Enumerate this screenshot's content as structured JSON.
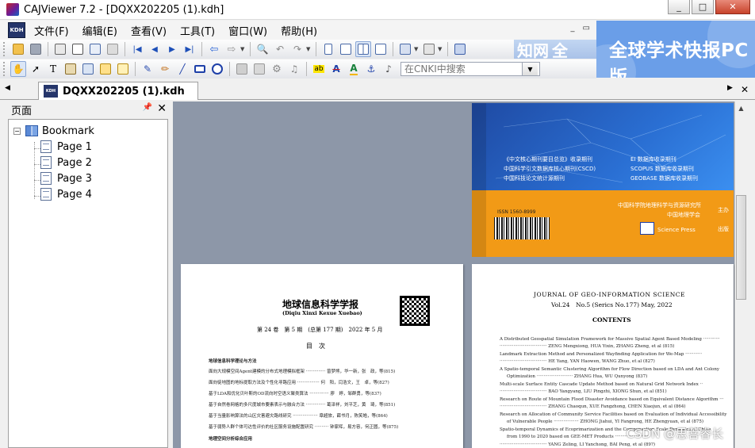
{
  "window": {
    "title": "CAJViewer 7.2 - [DQXX202205 (1).kdh]",
    "buttons": [
      "_",
      "□",
      "✕"
    ]
  },
  "menu": {
    "items": [
      "文件(F)",
      "编辑(E)",
      "查看(V)",
      "工具(T)",
      "窗口(W)",
      "帮助(H)"
    ],
    "mdi_buttons": [
      "_",
      "▭"
    ]
  },
  "toolbar": {
    "search_placeholder": "在CNKI中搜索"
  },
  "banner": {
    "text": "全球学术快报PC版",
    "overlay_fragments": [
      "知网",
      "全"
    ]
  },
  "document_tab": {
    "label": "DQXX202205 (1).kdh"
  },
  "left_panel": {
    "title": "页面",
    "pin_icon": "pin-icon",
    "tree": {
      "root": "Bookmark",
      "children": [
        "Page 1",
        "Page 2",
        "Page 3",
        "Page 4"
      ]
    }
  },
  "cover": {
    "left_lines": [
      "《中文核心期刊要目总览》收录期刊",
      "中国科学引文数据库核心期刊(CSCD)",
      "中国科技论文统计源期刊"
    ],
    "right_lines": [
      "EI 数据库收录期刊",
      "SCOPUS 数据库收录期刊",
      "GEOBASE 数据库收录期刊"
    ],
    "sponsor_lines": [
      "中国科学院地理科学与资源研究所",
      "中国地理学会"
    ],
    "sponsor_suffix": "主办",
    "issn": "ISSN 1560-8999",
    "publisher": "Science Press",
    "publisher_suffix": "出版"
  },
  "page_left": {
    "title": "地球信息科学学报",
    "subtitle": "(Diqiu Xinxi Kexue Xuebao)",
    "issue": "第 24 卷　第 5 期　(总第 177 期)　2022 年 5 月",
    "contents_label": "目　次",
    "section1": "地球信息科学理论与方法",
    "toc": [
      "面向大规模空间Agent建模的分布式地理模拟框架 ·············· 曾梦熊，华一新，张　政，等(815)",
      "面向徒地图的地标提取方法及个性化寻路应用 ················ 何　阳，闫浩文，王　卓，等(827)",
      "基于LDA和优化贝叶斯的OD流向时空语义聚类算法 ·············· 廖　婷，邹群勇，等(837)",
      "基于自然卷网格的多尺度城市要素表示与融合方法 ·············· 葛泽祥，刘平芝，黄　琦，等(851)",
      "基于当量影响算法的山区灾害避灾路线研究 ·················· 章超旅，薛书月，陈笑皓，等(864)",
      "基于弱势人群个体可达性评价的社区服务设施配置研究 ·········· 钟家晖，易方容，何正圆，等(875)"
    ],
    "section2": "地理空间分析综合应用"
  },
  "page_right": {
    "journal": "JOURNAL OF GEO-INFORMATION SCIENCE",
    "volume": "Vol.24　No.5 (Serics No.177) May, 2022",
    "contents_label": "CONTENTS",
    "toc": [
      "A Distributed Geospatial Simulation Framework for Massive Spatial Agent Based Modeling ············",
      "·································· ZENG Mengxiong, HUA Yixin, ZHANG Zheng, et al (815)",
      "Landmark Extraction Method and Personalized Wayfinding Application for We-Map ············",
      "·································· HE Yang, YAN Haowen, WANG Zhuo, et al (827)",
      "A Spatio-temporal Semantic Clustering Algorithm for Flow Direction based on LDA and Ant Colony",
      "Optimization ·························· ZHANG Hua, WU Qunyong (837)",
      "Multi-scale Surface Entity Cascade Update Method based on Natural Grid Network Index ··",
      "·································· BAO Yangyang, LIU Pingzhi, XIONG Shun, et al (851)",
      "Research on Route of Mountain Flood Disaster Avoidance based on Equivalent Distance Algorithm ···",
      "·································· ZHANG Chaoqun, XUE Fangzhong, CHEN Xiaojun, et al (864)",
      "Research on Allocation of Community Service Facilities based on Evaluation of Individual Accessibility",
      "of Vulnerable People ·················· ZHONG Jiahui, YI Fangrong, HE Zhengyuan, et al (875)",
      "Spatio-temporal Dynamics of Ecoprimarization and the Compensation Scale Dynamics of China",
      "from 1990 to 2020 based on GEE-MET Products ·························",
      "·································· YANG Zeling, LI Yanchong, BAI Peng, et al (89?)"
    ]
  },
  "watermark": "CSDN @思菩睿长",
  "colors": {
    "view_bg": "#8d97a8",
    "cover_orange": "#f29a16",
    "cover_blue": "#2a6fd3",
    "banner_blue": "#6a9ee8",
    "kdh_navy": "#25356a"
  }
}
